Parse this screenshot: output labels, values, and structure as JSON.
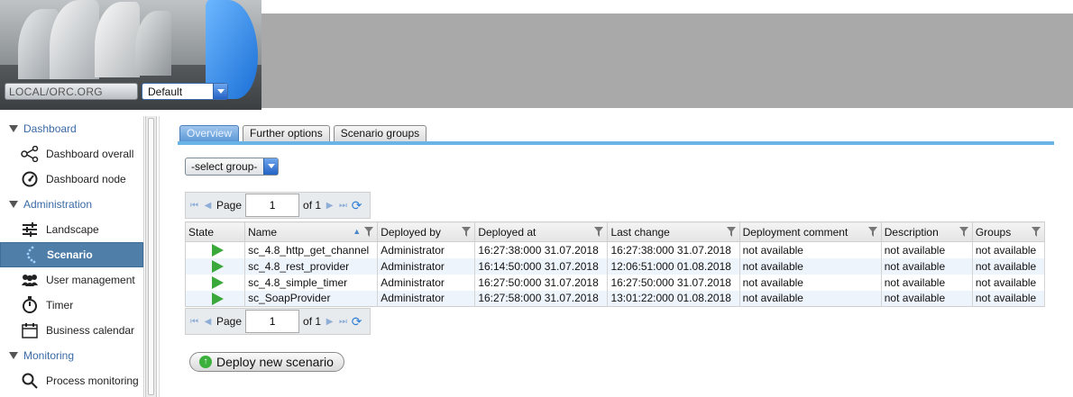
{
  "header": {
    "org_select": "LOCAL/ORC.ORG",
    "env_select": "Default"
  },
  "sidebar": {
    "sections": [
      {
        "label": "Dashboard",
        "items": [
          {
            "label": "Dashboard overall",
            "icon": "network-nodes-icon"
          },
          {
            "label": "Dashboard node",
            "icon": "gauge-icon"
          }
        ]
      },
      {
        "label": "Administration",
        "items": [
          {
            "label": "Landscape",
            "icon": "sliders-icon"
          },
          {
            "label": "Scenario",
            "icon": "dotted-arc-icon"
          },
          {
            "label": "User management",
            "icon": "users-icon"
          },
          {
            "label": "Timer",
            "icon": "stopwatch-icon"
          },
          {
            "label": "Business calendar",
            "icon": "calendar-icon"
          }
        ]
      },
      {
        "label": "Monitoring",
        "items": [
          {
            "label": "Process monitoring",
            "icon": "magnifier-icon"
          }
        ]
      }
    ]
  },
  "tabs": [
    "Overview",
    "Further options",
    "Scenario groups"
  ],
  "group_select": "-select group-",
  "pager": {
    "label": "Page",
    "page": "1",
    "of_label": "of 1"
  },
  "grid": {
    "columns": [
      "State",
      "Name",
      "Deployed by",
      "Deployed at",
      "Last change",
      "Deployment comment",
      "Description",
      "Groups"
    ],
    "rows": [
      [
        "sc_4.8_http_get_channel",
        "Administrator",
        "16:27:38:000 31.07.2018",
        "16:27:38:000 31.07.2018",
        "not available",
        "not available",
        "not available"
      ],
      [
        "sc_4.8_rest_provider",
        "Administrator",
        "16:14:50:000 31.07.2018",
        "12:06:51:000 01.08.2018",
        "not available",
        "not available",
        "not available"
      ],
      [
        "sc_4.8_simple_timer",
        "Administrator",
        "16:27:50:000 31.07.2018",
        "16:27:50:000 31.07.2018",
        "not available",
        "not available",
        "not available"
      ],
      [
        "sc_SoapProvider",
        "Administrator",
        "16:27:58:000 31.07.2018",
        "13:01:22:000 01.08.2018",
        "not available",
        "not available",
        "not available"
      ]
    ]
  },
  "deploy_button": "Deploy new scenario"
}
